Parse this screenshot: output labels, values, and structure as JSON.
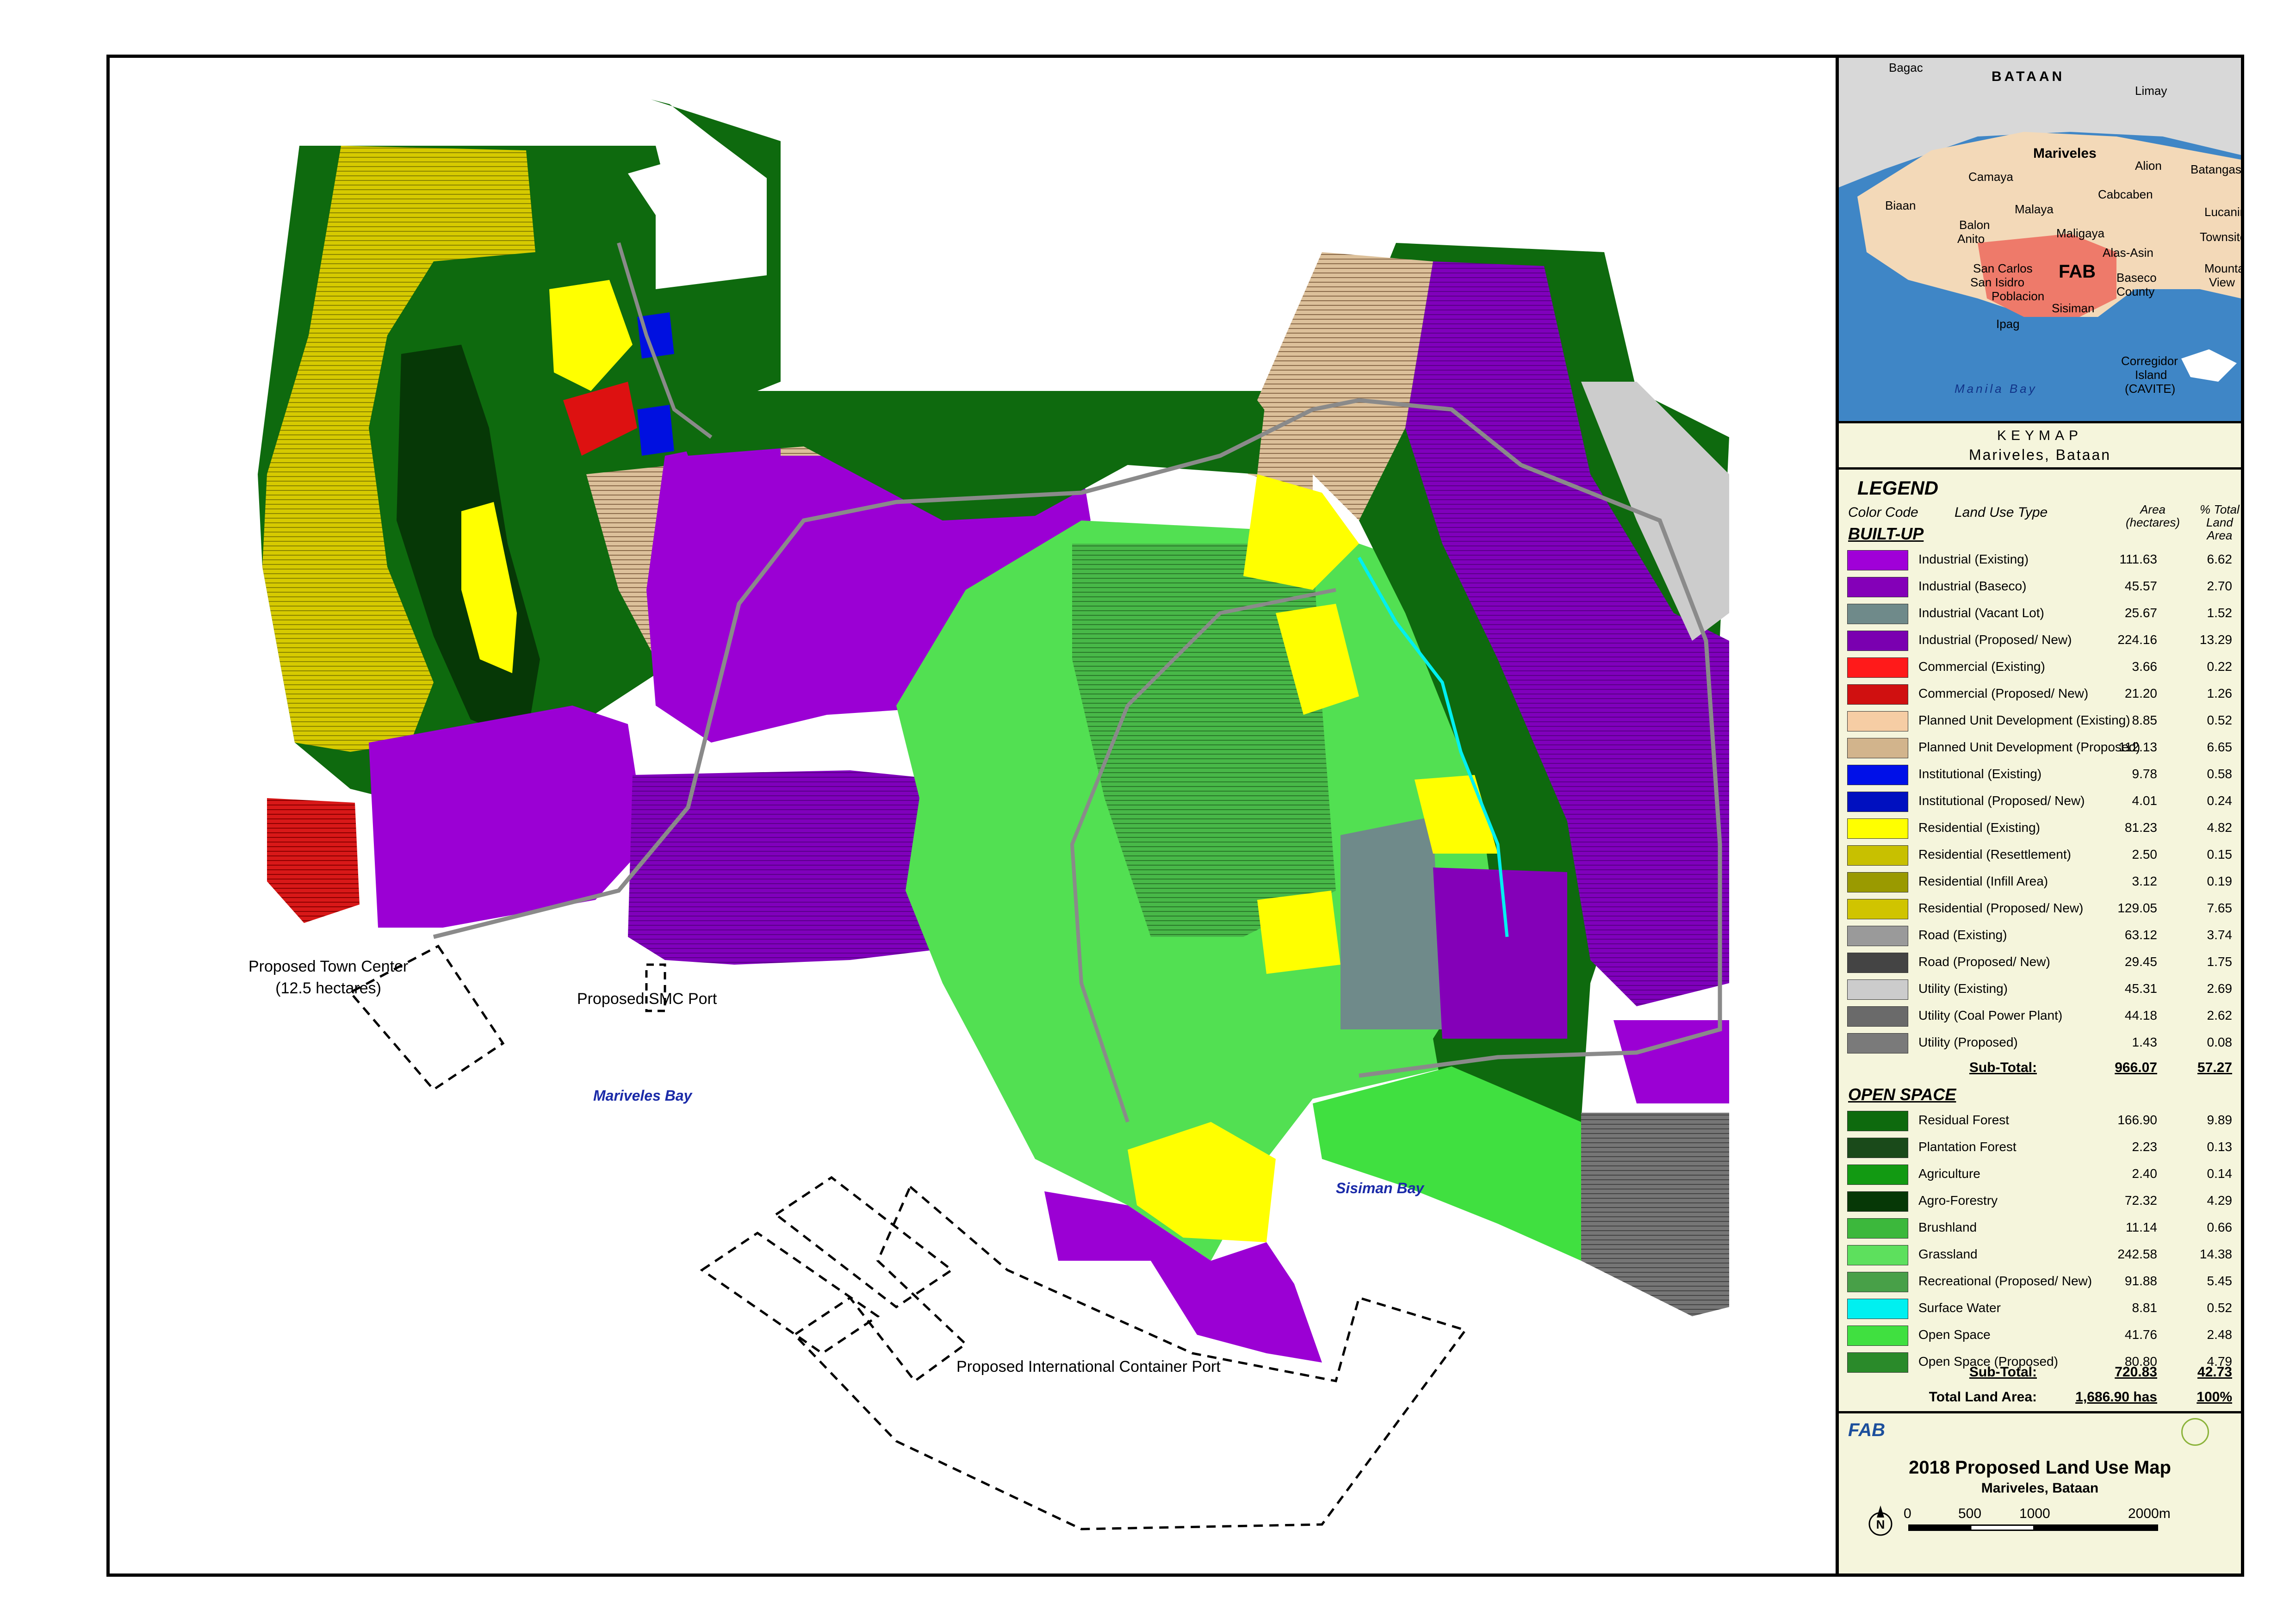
{
  "map": {
    "labels": {
      "town_center": "Proposed Town Center",
      "town_center_area": "(12.5 hectares)",
      "smc_port": "Proposed SMC Port",
      "container_port": "Proposed International Container Port",
      "mariveles_bay": "Mariveles Bay",
      "sisiman_bay": "Sisiman Bay"
    }
  },
  "keymap": {
    "labels": {
      "bagac": "Bagac",
      "bataan": "BATAAN",
      "limay": "Limay",
      "mariveles": "Mariveles",
      "alion": "Alion",
      "batangas": "Batangas",
      "camaya": "Camaya",
      "cabcaben": "Cabcaben",
      "biaan": "Biaan",
      "malaya": "Malaya",
      "lucanin": "Lucanin",
      "balon": "Balon",
      "anito": "Anito",
      "maligaya": "Maligaya",
      "townsite": "Townsite",
      "alas_asin": "Alas-Asin",
      "san_carlos": "San Carlos",
      "fab": "FAB",
      "san_isidro": "San Isidro",
      "baseco": "Baseco",
      "county": "County",
      "mountain": "Mountain",
      "view": "View",
      "poblacion": "Poblacion",
      "sisiman": "Sisiman",
      "ipag": "Ipag",
      "corregidor": "Corregidor",
      "island": "Island",
      "cavite": "(CAVITE)",
      "manila_bay": "Manila Bay"
    },
    "caption_title": "KEYMAP",
    "caption_place": "Mariveles, Bataan"
  },
  "legend": {
    "title": "LEGEND",
    "col_color": "Color Code",
    "col_type": "Land Use Type",
    "col_area_1": "Area",
    "col_area_2": "(hectares)",
    "col_pct_1": "% Total",
    "col_pct_2": "Land",
    "col_pct_3": "Area",
    "built_up_title": "BUILT-UP",
    "built_up": [
      {
        "name": "Industrial (Existing)",
        "area": "111.63",
        "pct": "6.62",
        "color": "#a000d8"
      },
      {
        "name": "Industrial (Baseco)",
        "area": "45.57",
        "pct": "2.70",
        "color": "#8400b8"
      },
      {
        "name": "Industrial (Vacant Lot)",
        "area": "25.67",
        "pct": "1.52",
        "color": "#6f8a8a"
      },
      {
        "name": "Industrial (Proposed/ New)",
        "area": "224.16",
        "pct": "13.29",
        "color": "#7a00b0"
      },
      {
        "name": "Commercial (Existing)",
        "area": "3.66",
        "pct": "0.22",
        "color": "#ff1a1a"
      },
      {
        "name": "Commercial (Proposed/ New)",
        "area": "21.20",
        "pct": "1.26",
        "color": "#d01010"
      },
      {
        "name": "Planned Unit Development (Existing)",
        "area": "8.85",
        "pct": "0.52",
        "color": "#f6cda4"
      },
      {
        "name": "Planned Unit Development (Proposed)",
        "area": "112.13",
        "pct": "6.65",
        "color": "#d2b48c"
      },
      {
        "name": "Institutional (Existing)",
        "area": "9.78",
        "pct": "0.58",
        "color": "#0010e8"
      },
      {
        "name": "Institutional (Proposed/ New)",
        "area": "4.01",
        "pct": "0.24",
        "color": "#0010c0"
      },
      {
        "name": "Residential (Existing)",
        "area": "81.23",
        "pct": "4.82",
        "color": "#ffff00"
      },
      {
        "name": "Residential (Resettlement)",
        "area": "2.50",
        "pct": "0.15",
        "color": "#c8c000"
      },
      {
        "name": "Residential (Infill Area)",
        "area": "3.12",
        "pct": "0.19",
        "color": "#9a9a00"
      },
      {
        "name": "Residential (Proposed/ New)",
        "area": "129.05",
        "pct": "7.65",
        "color": "#d0c400"
      },
      {
        "name": "Road (Existing)",
        "area": "63.12",
        "pct": "3.74",
        "color": "#9a9a9a"
      },
      {
        "name": "Road (Proposed/ New)",
        "area": "29.45",
        "pct": "1.75",
        "color": "#444444"
      },
      {
        "name": "Utility (Existing)",
        "area": "45.31",
        "pct": "2.69",
        "color": "#cccccc"
      },
      {
        "name": "Utility (Coal Power Plant)",
        "area": "44.18",
        "pct": "2.62",
        "color": "#6a6a6a"
      },
      {
        "name": "Utility (Proposed)",
        "area": "1.43",
        "pct": "0.08",
        "color": "#7a7a7a"
      }
    ],
    "built_up_subtotal": {
      "label": "Sub-Total:",
      "area": "966.07",
      "pct": "57.27"
    },
    "open_space_title": "OPEN SPACE",
    "open_space": [
      {
        "name": "Residual Forest",
        "area": "166.90",
        "pct": "9.89",
        "color": "#0e6a0e"
      },
      {
        "name": "Plantation Forest",
        "area": "2.23",
        "pct": "0.13",
        "color": "#1a4a1a"
      },
      {
        "name": "Agriculture",
        "area": "2.40",
        "pct": "0.14",
        "color": "#129a12"
      },
      {
        "name": "Agro-Forestry",
        "area": "72.32",
        "pct": "4.29",
        "color": "#063806"
      },
      {
        "name": "Brushland",
        "area": "11.14",
        "pct": "0.66",
        "color": "#3cb83c"
      },
      {
        "name": "Grassland",
        "area": "242.58",
        "pct": "14.38",
        "color": "#5de05d"
      },
      {
        "name": "Recreational (Proposed/ New)",
        "area": "91.88",
        "pct": "5.45",
        "color": "#48a048"
      },
      {
        "name": "Surface Water",
        "area": "8.81",
        "pct": "0.52",
        "color": "#00f0f0"
      },
      {
        "name": "Open Space",
        "area": "41.76",
        "pct": "2.48",
        "color": "#40e040"
      },
      {
        "name": "Open Space  (Proposed)",
        "area": "80.80",
        "pct": "4.79",
        "color": "#2a8a2a"
      }
    ],
    "open_space_subtotal": {
      "label": "Sub-Total:",
      "area": "720.83",
      "pct": "42.73"
    },
    "total": {
      "label": "Total Land Area:",
      "area": "1,686.90 has",
      "pct": "100%"
    }
  },
  "title_block": {
    "logo": "FAB",
    "title": "2018 Proposed Land Use Map",
    "subtitle": "Mariveles, Bataan",
    "north": "N",
    "scale": [
      "0",
      "500",
      "1000",
      "2000m"
    ]
  },
  "colors": {
    "industrial": "#9b00d4",
    "industrial_dark": "#7400ac",
    "residual_forest": "#0e6a0e",
    "agro_forestry": "#063806",
    "grassland": "#52e052",
    "residential_proposed": "#c8bc00",
    "residential": "#ffff00",
    "pud": "#d2b48c",
    "utility": "#cccccc",
    "coal": "#6a6a6a",
    "commercial": "#ee1111",
    "institutional": "#0010e0",
    "water_keymap": "#3f86c6",
    "land_keymap": "#f3d9b8",
    "fab_zone": "#ee7a6a"
  }
}
